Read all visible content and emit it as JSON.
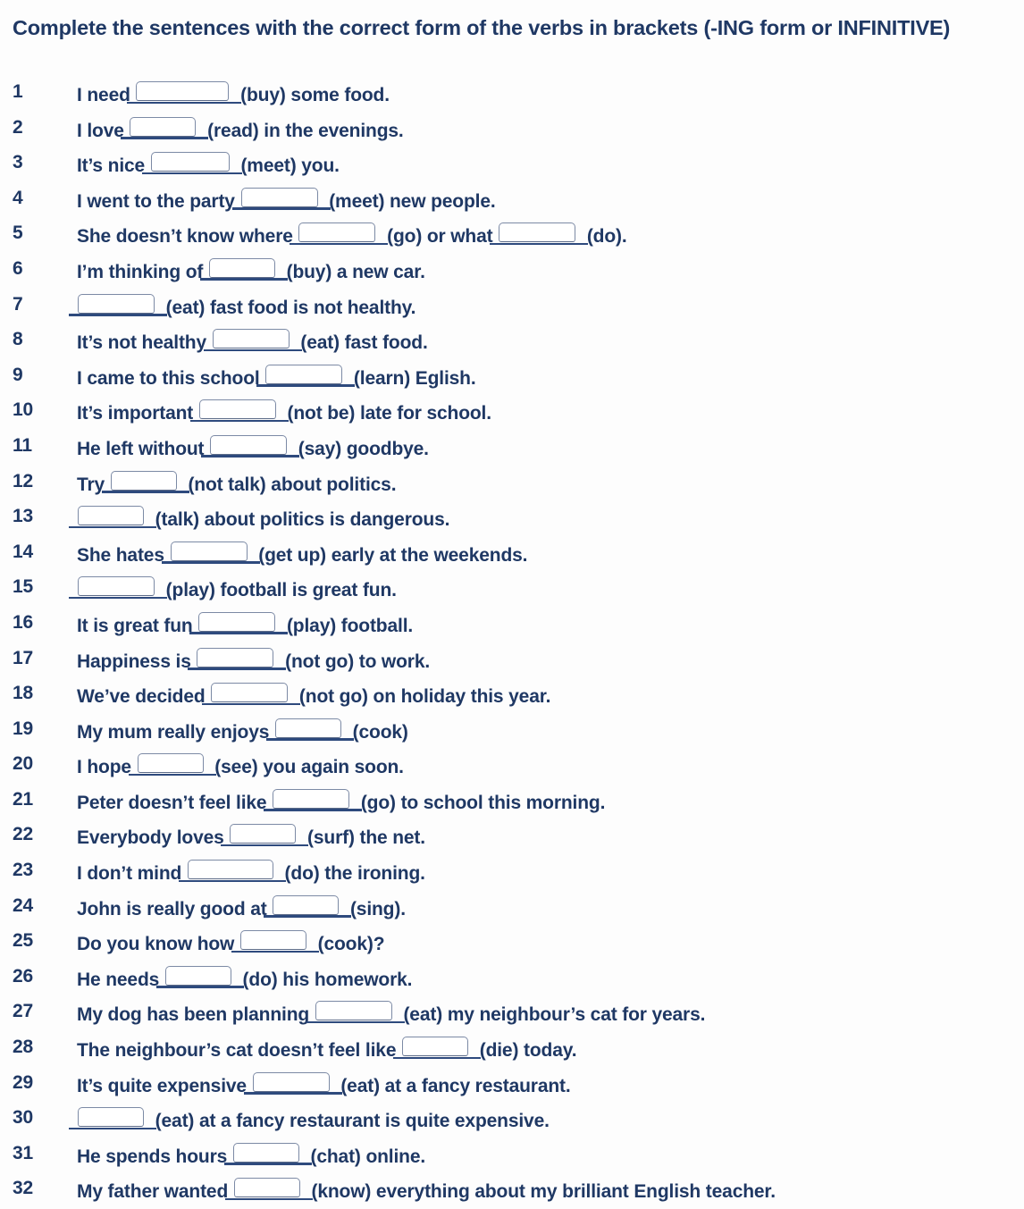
{
  "worksheet": {
    "title": "Complete the sentences with the correct form of the verbs in brackets (-ING form or INFINITIVE)",
    "text_color": "#1f3864",
    "blank_rule_color": "#2e4a7d",
    "blank_field_border_color": "#7c8aa5",
    "background_color": "#fdfdfd",
    "item_count": 32,
    "items": [
      {
        "number": "1",
        "parts": [
          {
            "t": "text",
            "v": "I need "
          },
          {
            "t": "blank",
            "w": 0
          },
          {
            "t": "text",
            "v": " (buy) some food."
          }
        ]
      },
      {
        "number": "2",
        "parts": [
          {
            "t": "text",
            "v": "I love "
          },
          {
            "t": "blank",
            "w": 5
          },
          {
            "t": "text",
            "v": " (read) in the evenings."
          }
        ]
      },
      {
        "number": "3",
        "parts": [
          {
            "t": "text",
            "v": "It’s nice "
          },
          {
            "t": "blank",
            "w": 2
          },
          {
            "t": "text",
            "v": " (meet) you."
          }
        ]
      },
      {
        "number": "4",
        "parts": [
          {
            "t": "text",
            "v": "I went to the party "
          },
          {
            "t": "blank",
            "w": 4
          },
          {
            "t": "text",
            "v": " (meet) new people."
          }
        ]
      },
      {
        "number": "5",
        "parts": [
          {
            "t": "text",
            "v": "She doesn’t know where "
          },
          {
            "t": "blank",
            "w": 4
          },
          {
            "t": "text",
            "v": " (go) or what "
          },
          {
            "t": "blank",
            "w": 4
          },
          {
            "t": "text",
            "v": " (do)."
          }
        ]
      },
      {
        "number": "6",
        "parts": [
          {
            "t": "text",
            "v": "I’m thinking of "
          },
          {
            "t": "blank",
            "w": 5
          },
          {
            "t": "text",
            "v": " (buy) a new car."
          }
        ]
      },
      {
        "number": "7",
        "parts": [
          {
            "t": "blank",
            "w": 4
          },
          {
            "t": "text",
            "v": " (eat) fast food is not healthy."
          }
        ]
      },
      {
        "number": "8",
        "parts": [
          {
            "t": "text",
            "v": "It’s not healthy "
          },
          {
            "t": "blank",
            "w": 4
          },
          {
            "t": "text",
            "v": " (eat) fast food."
          }
        ]
      },
      {
        "number": "9",
        "parts": [
          {
            "t": "text",
            "v": "I came to this school "
          },
          {
            "t": "blank",
            "w": 4
          },
          {
            "t": "text",
            "v": " (learn) Eglish."
          }
        ]
      },
      {
        "number": "10",
        "parts": [
          {
            "t": "text",
            "v": "It’s important "
          },
          {
            "t": "blank",
            "w": 4
          },
          {
            "t": "text",
            "v": " (not be) late for school."
          }
        ]
      },
      {
        "number": "11",
        "parts": [
          {
            "t": "text",
            "v": "He left without "
          },
          {
            "t": "blank",
            "w": 4
          },
          {
            "t": "text",
            "v": " (say) goodbye."
          }
        ]
      },
      {
        "number": "12",
        "parts": [
          {
            "t": "text",
            "v": "Try "
          },
          {
            "t": "blank",
            "w": 5
          },
          {
            "t": "text",
            "v": " (not talk) about politics."
          }
        ]
      },
      {
        "number": "13",
        "parts": [
          {
            "t": "blank",
            "w": 5
          },
          {
            "t": "text",
            "v": " (talk) about politics is dangerous."
          }
        ]
      },
      {
        "number": "14",
        "parts": [
          {
            "t": "text",
            "v": "She hates "
          },
          {
            "t": "blank",
            "w": 4
          },
          {
            "t": "text",
            "v": " (get up) early at the weekends."
          }
        ]
      },
      {
        "number": "15",
        "parts": [
          {
            "t": "blank",
            "w": 4
          },
          {
            "t": "text",
            "v": " (play) football is great fun."
          }
        ]
      },
      {
        "number": "16",
        "parts": [
          {
            "t": "text",
            "v": "It is great fun "
          },
          {
            "t": "blank",
            "w": 4
          },
          {
            "t": "text",
            "v": " (play) football."
          }
        ]
      },
      {
        "number": "17",
        "parts": [
          {
            "t": "text",
            "v": "Happiness is "
          },
          {
            "t": "blank",
            "w": 4
          },
          {
            "t": "text",
            "v": " (not go) to work."
          }
        ]
      },
      {
        "number": "18",
        "parts": [
          {
            "t": "text",
            "v": "We’ve decided "
          },
          {
            "t": "blank",
            "w": 4
          },
          {
            "t": "text",
            "v": " (not go) on holiday this year."
          }
        ]
      },
      {
        "number": "19",
        "parts": [
          {
            "t": "text",
            "v": "My mum really enjoys "
          },
          {
            "t": "blank",
            "w": 5
          },
          {
            "t": "text",
            "v": " (cook)"
          }
        ]
      },
      {
        "number": "20",
        "parts": [
          {
            "t": "text",
            "v": "I hope "
          },
          {
            "t": "blank",
            "w": 5
          },
          {
            "t": "text",
            "v": " (see) you again soon."
          }
        ]
      },
      {
        "number": "21",
        "parts": [
          {
            "t": "text",
            "v": "Peter doesn’t feel like "
          },
          {
            "t": "blank",
            "w": 4
          },
          {
            "t": "text",
            "v": " (go) to school this morning."
          }
        ]
      },
      {
        "number": "22",
        "parts": [
          {
            "t": "text",
            "v": "Everybody loves "
          },
          {
            "t": "blank",
            "w": 5
          },
          {
            "t": "text",
            "v": " (surf) the net."
          }
        ]
      },
      {
        "number": "23",
        "parts": [
          {
            "t": "text",
            "v": "I don’t mind "
          },
          {
            "t": "blank",
            "w": 3
          },
          {
            "t": "text",
            "v": " (do) the ironing."
          }
        ]
      },
      {
        "number": "24",
        "parts": [
          {
            "t": "text",
            "v": "John is really good at "
          },
          {
            "t": "blank",
            "w": 5
          },
          {
            "t": "text",
            "v": " (sing)."
          }
        ]
      },
      {
        "number": "25",
        "parts": [
          {
            "t": "text",
            "v": "Do you know how "
          },
          {
            "t": "blank",
            "w": 5
          },
          {
            "t": "text",
            "v": " (cook)?"
          }
        ]
      },
      {
        "number": "26",
        "parts": [
          {
            "t": "text",
            "v": "He needs "
          },
          {
            "t": "blank",
            "w": 5
          },
          {
            "t": "text",
            "v": " (do) his homework."
          }
        ]
      },
      {
        "number": "27",
        "parts": [
          {
            "t": "text",
            "v": "My dog has been planning "
          },
          {
            "t": "blank",
            "w": 4
          },
          {
            "t": "text",
            "v": " (eat) my neighbour’s cat for years."
          }
        ]
      },
      {
        "number": "28",
        "parts": [
          {
            "t": "text",
            "v": "The neighbour’s cat doesn’t feel like "
          },
          {
            "t": "blank",
            "w": 5
          },
          {
            "t": "text",
            "v": " (die) today."
          }
        ]
      },
      {
        "number": "29",
        "parts": [
          {
            "t": "text",
            "v": "It’s quite expensive "
          },
          {
            "t": "blank",
            "w": 4
          },
          {
            "t": "text",
            "v": " (eat) at a fancy restaurant."
          }
        ]
      },
      {
        "number": "30",
        "parts": [
          {
            "t": "blank",
            "w": 5
          },
          {
            "t": "text",
            "v": " (eat) at a fancy restaurant is quite expensive."
          }
        ]
      },
      {
        "number": "31",
        "parts": [
          {
            "t": "text",
            "v": "He spends hours "
          },
          {
            "t": "blank",
            "w": 5
          },
          {
            "t": "text",
            "v": " (chat) online."
          }
        ]
      },
      {
        "number": "32",
        "parts": [
          {
            "t": "text",
            "v": "My father wanted "
          },
          {
            "t": "blank",
            "w": 5
          },
          {
            "t": "text",
            "v": " (know) everything about my brilliant English teacher."
          }
        ]
      }
    ]
  }
}
